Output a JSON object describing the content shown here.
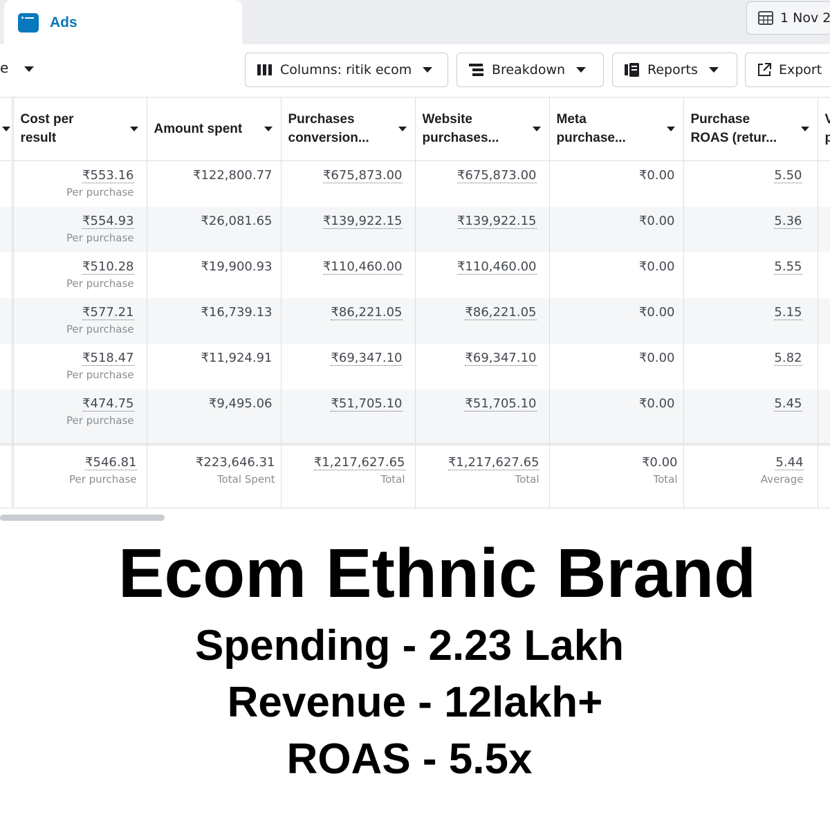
{
  "tab": {
    "label": "Ads",
    "icon": "ads-manager-icon"
  },
  "date_range": {
    "label": "1 Nov 2"
  },
  "toolbar": {
    "left_fragment": "e",
    "columns_label": "Columns: ritik ecom",
    "breakdown_label": "Breakdown",
    "reports_label": "Reports",
    "export_label": "Export"
  },
  "table": {
    "headers": [
      {
        "line1": "Cost per",
        "line2": "result"
      },
      {
        "line1": "Amount spent",
        "line2": ""
      },
      {
        "line1": "Purchases",
        "line2": "conversion..."
      },
      {
        "line1": "Website",
        "line2": "purchases..."
      },
      {
        "line1": "Meta",
        "line2": "purchase..."
      },
      {
        "line1": "Purchase",
        "line2": "ROAS (retur..."
      }
    ],
    "last_header_fragment": {
      "line1": "V",
      "line2": "p"
    },
    "rows": [
      {
        "cost": "₹553.16",
        "cost_sub": "Per purchase",
        "spent": "₹122,800.77",
        "conv": "₹675,873.00",
        "web": "₹675,873.00",
        "meta": "₹0.00",
        "roas": "5.50"
      },
      {
        "cost": "₹554.93",
        "cost_sub": "Per purchase",
        "spent": "₹26,081.65",
        "conv": "₹139,922.15",
        "web": "₹139,922.15",
        "meta": "₹0.00",
        "roas": "5.36"
      },
      {
        "cost": "₹510.28",
        "cost_sub": "Per purchase",
        "spent": "₹19,900.93",
        "conv": "₹110,460.00",
        "web": "₹110,460.00",
        "meta": "₹0.00",
        "roas": "5.55"
      },
      {
        "cost": "₹577.21",
        "cost_sub": "Per purchase",
        "spent": "₹16,739.13",
        "conv": "₹86,221.05",
        "web": "₹86,221.05",
        "meta": "₹0.00",
        "roas": "5.15"
      },
      {
        "cost": "₹518.47",
        "cost_sub": "Per purchase",
        "spent": "₹11,924.91",
        "conv": "₹69,347.10",
        "web": "₹69,347.10",
        "meta": "₹0.00",
        "roas": "5.82"
      },
      {
        "cost": "₹474.75",
        "cost_sub": "Per purchase",
        "spent": "₹9,495.06",
        "conv": "₹51,705.10",
        "web": "₹51,705.10",
        "meta": "₹0.00",
        "roas": "5.45"
      }
    ],
    "totals": {
      "cost": "₹546.81",
      "cost_sub": "Per purchase",
      "spent": "₹223,646.31",
      "spent_sub": "Total Spent",
      "conv": "₹1,217,627.65",
      "conv_sub": "Total",
      "web": "₹1,217,627.65",
      "web_sub": "Total",
      "meta": "₹0.00",
      "meta_sub": "Total",
      "roas": "5.44",
      "roas_sub": "Average"
    }
  },
  "overlay": {
    "title": "Ecom Ethnic Brand",
    "line1": "Spending - 2.23 Lakh",
    "line2": "Revenue - 12lakh+",
    "line3": "ROAS - 5.5x"
  }
}
